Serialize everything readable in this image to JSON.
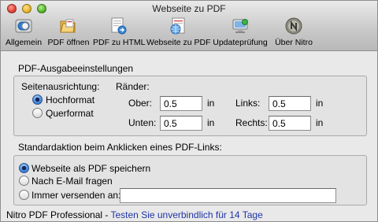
{
  "window": {
    "title": "Webseite zu PDF"
  },
  "toolbar": {
    "items": [
      {
        "label": "Allgemein",
        "icon": "switch-icon"
      },
      {
        "label": "PDF öffnen",
        "icon": "folder-open-icon"
      },
      {
        "label": "PDF zu HTML",
        "icon": "pdf-to-html-icon"
      },
      {
        "label": "Webseite zu PDF",
        "icon": "globe-pdf-icon"
      },
      {
        "label": "Updateprüfung",
        "icon": "update-icon"
      },
      {
        "label": "Über Nitro",
        "icon": "nitro-logo-icon"
      }
    ]
  },
  "output_settings": {
    "title": "PDF-Ausgabeeinstellungen",
    "orientation_label": "Seitenausrichtung:",
    "portrait_label": "Hochformat",
    "landscape_label": "Querformat",
    "orientation_selected": "Hochformat",
    "margins_label": "Ränder:",
    "top_label": "Ober:",
    "top_value": "0.5",
    "bottom_label": "Unten:",
    "bottom_value": "0.5",
    "left_label": "Links:",
    "left_value": "0.5",
    "right_label": "Rechts:",
    "right_value": "0.5",
    "unit": "in"
  },
  "default_action": {
    "title": "Standardaktion beim Anklicken eines PDF-Links:",
    "options": [
      "Webseite als PDF speichern",
      "Nach E-Mail fragen",
      "Immer versenden an:"
    ],
    "selected_index": 0,
    "send_to_value": ""
  },
  "footer": {
    "text": "Nitro PDF Professional - ",
    "link": "Testen Sie unverbindlich für 14 Tage"
  },
  "colors": {
    "link": "#2035a8",
    "accent": "#4a8ee0"
  }
}
